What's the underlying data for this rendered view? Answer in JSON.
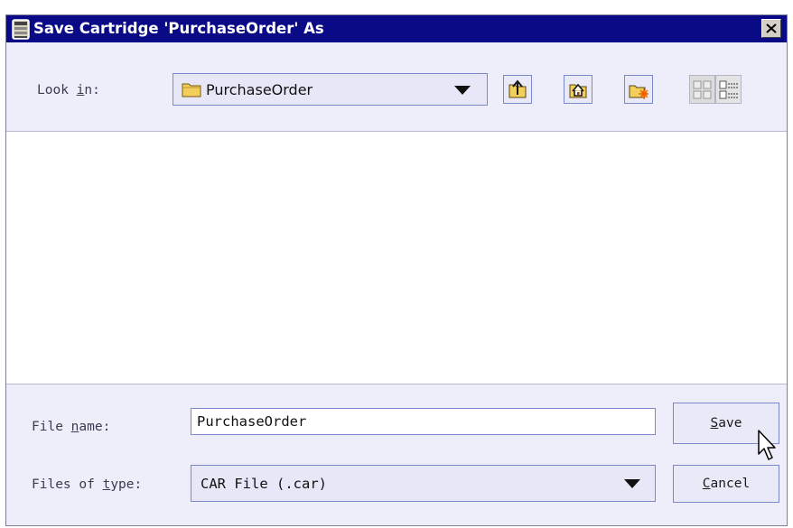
{
  "window": {
    "title": "Save Cartridge 'PurchaseOrder' As"
  },
  "look_in": {
    "label_pre": "Look ",
    "label_mnemonic": "i",
    "label_post": "n:",
    "value": "PurchaseOrder"
  },
  "toolbar": {
    "up_folder": "up-one-level-icon",
    "home": "home-folder-icon",
    "new_folder": "new-folder-icon",
    "list_view": "list-view-icon",
    "details_view": "details-view-icon"
  },
  "file_list": {
    "items": []
  },
  "file_name": {
    "label_pre": "File ",
    "label_mnemonic": "n",
    "label_post": "ame:",
    "value": "PurchaseOrder"
  },
  "file_type": {
    "label_pre": "Files of ",
    "label_mnemonic": "t",
    "label_post": "ype:",
    "value": "CAR File (.car)"
  },
  "buttons": {
    "save_mnemonic": "S",
    "save_rest": "ave",
    "cancel_mnemonic": "C",
    "cancel_rest": "ancel"
  },
  "colors": {
    "titlebar": "#0a0a86",
    "dialog_bg": "#eeeefa",
    "border_accent": "#7a88cc"
  }
}
